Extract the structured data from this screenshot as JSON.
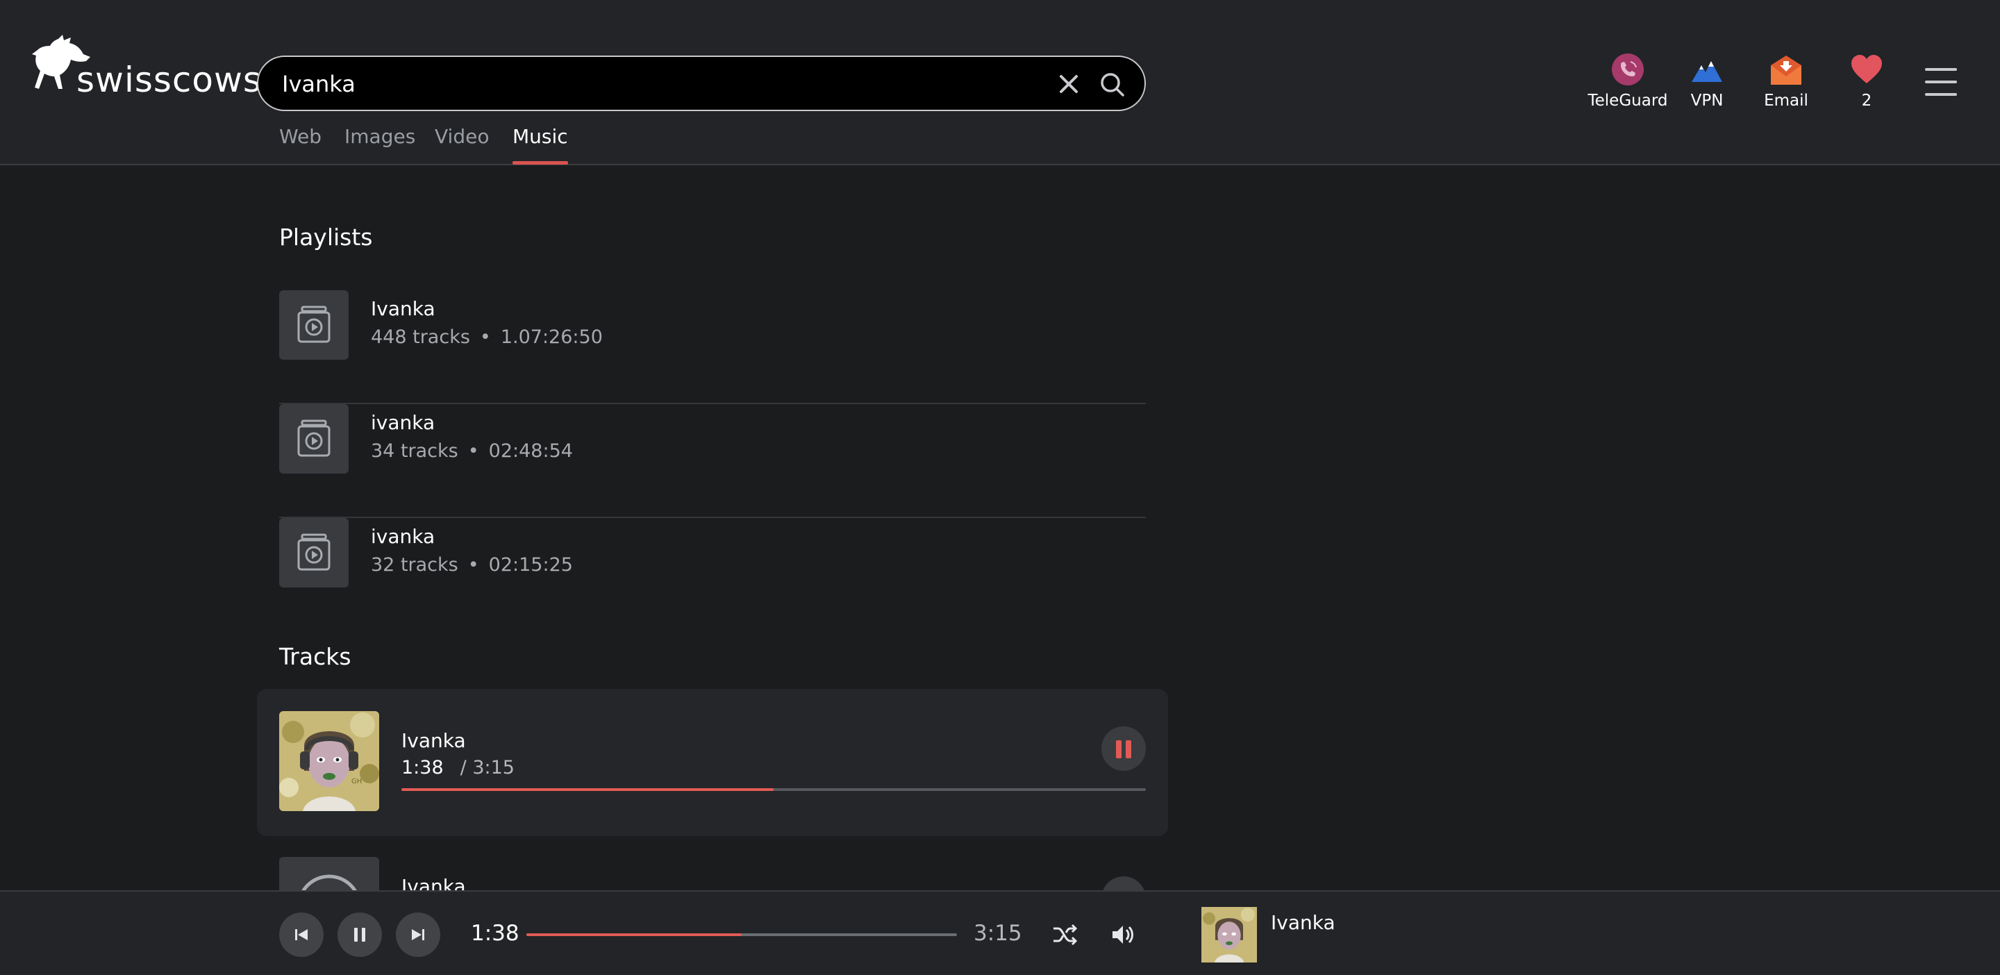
{
  "brand": {
    "name": "swisscows"
  },
  "search": {
    "query": "Ivanka"
  },
  "tabs": [
    {
      "label": "Web",
      "active": false
    },
    {
      "label": "Images",
      "active": false
    },
    {
      "label": "Video",
      "active": false
    },
    {
      "label": "Music",
      "active": true
    }
  ],
  "header_apps": [
    {
      "label": "TeleGuard",
      "icon": "teleguard-icon",
      "color": "#a63a6a"
    },
    {
      "label": "VPN",
      "icon": "vpn-mountain-icon",
      "color": "#2f6fd6"
    },
    {
      "label": "Email",
      "icon": "email-icon",
      "color": "#e05a2e"
    },
    {
      "label": "2",
      "icon": "heart-icon",
      "color": "#e2545e"
    }
  ],
  "playlists_section": {
    "title": "Playlists",
    "items": [
      {
        "title": "Ivanka",
        "tracks": "448 tracks",
        "duration": "1.07:26:50"
      },
      {
        "title": "ivanka",
        "tracks": "34 tracks",
        "duration": "02:48:54"
      },
      {
        "title": "ivanka",
        "tracks": "32 tracks",
        "duration": "02:15:25"
      }
    ]
  },
  "tracks_section": {
    "title": "Tracks",
    "active_track": {
      "title": "Ivanka",
      "current_time": "1:38",
      "duration": "/ 3:15",
      "progress": 0.5
    },
    "next_track": {
      "title": "Ivanka"
    }
  },
  "player": {
    "current_time": "1:38",
    "duration": "3:15",
    "progress": 0.5,
    "title": "Ivanka"
  },
  "colors": {
    "accent": "#e25a55",
    "background": "#1b1c1e",
    "header": "#222427"
  }
}
